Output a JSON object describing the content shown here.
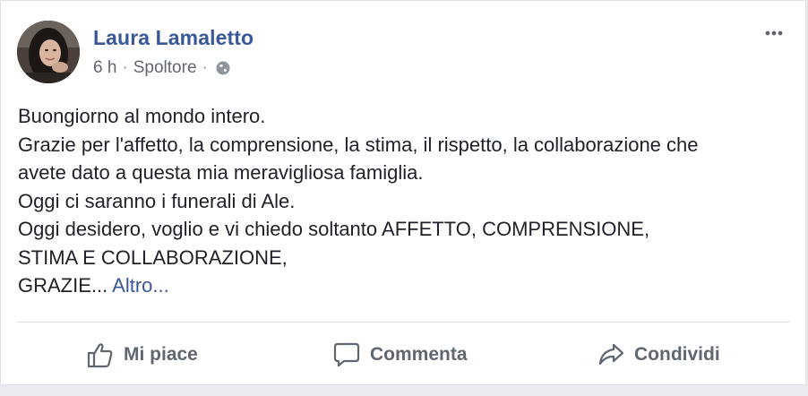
{
  "post": {
    "author": "Laura Lamaletto",
    "time": "6 h",
    "separator": "·",
    "location": "Spoltore",
    "privacy_icon": "globe-icon",
    "menu_icon": "more-options-icon",
    "body_lines": [
      "Buongiorno al mondo intero.",
      "Grazie per l'affetto, la comprensione, la stima, il rispetto, la collaborazione che",
      "avete dato a questa mia meravigliosa famiglia.",
      "Oggi ci saranno i funerali di Ale.",
      "Oggi desidero, voglio e vi chiedo soltanto AFFETTO, COMPRENSIONE,",
      "STIMA E COLLABORAZIONE,",
      "GRAZIE..."
    ],
    "more_link": "Altro..."
  },
  "actions": {
    "like": {
      "label": "Mi piace",
      "icon": "thumbs-up-icon"
    },
    "comment": {
      "label": "Commenta",
      "icon": "comment-icon"
    },
    "share": {
      "label": "Condividi",
      "icon": "share-icon"
    }
  },
  "colors": {
    "author": "#385898",
    "meta": "#616770",
    "body": "#1d2129",
    "action": "#606770",
    "divider": "#dadde1"
  }
}
